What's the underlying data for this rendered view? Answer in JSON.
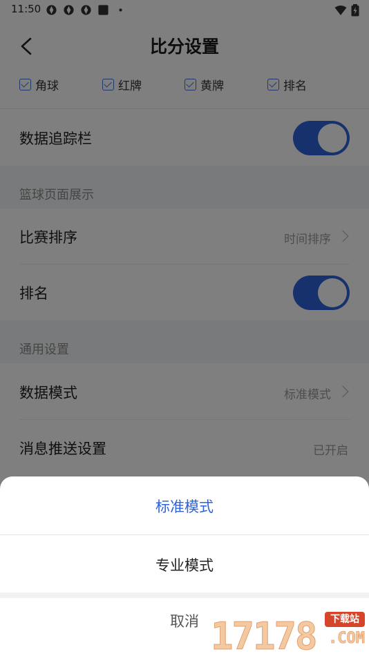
{
  "status_bar": {
    "time": "11:50"
  },
  "header": {
    "title": "比分设置"
  },
  "checks": [
    {
      "label": "角球"
    },
    {
      "label": "红牌"
    },
    {
      "label": "黄牌"
    },
    {
      "label": "排名"
    }
  ],
  "rows": {
    "tracker": {
      "label": "数据追踪栏",
      "enabled": true
    },
    "sort": {
      "label": "比赛排序",
      "value": "时间排序"
    },
    "ranking": {
      "label": "排名",
      "enabled": true
    },
    "data_mode": {
      "label": "数据模式",
      "value": "标准模式"
    },
    "push": {
      "label": "消息推送设置",
      "value": "已开启"
    }
  },
  "sections": {
    "basketball": "篮球页面展示",
    "general": "通用设置"
  },
  "sheet": {
    "options": [
      {
        "label": "标准模式",
        "selected": true
      },
      {
        "label": "专业模式",
        "selected": false
      }
    ],
    "cancel": "取消"
  },
  "watermark": {
    "digits": "17178",
    "badge": "下载站",
    "suffix": ".COM"
  },
  "colors": {
    "accent": "#2f62d8",
    "overlay": "rgba(0,0,0,0.5)"
  }
}
